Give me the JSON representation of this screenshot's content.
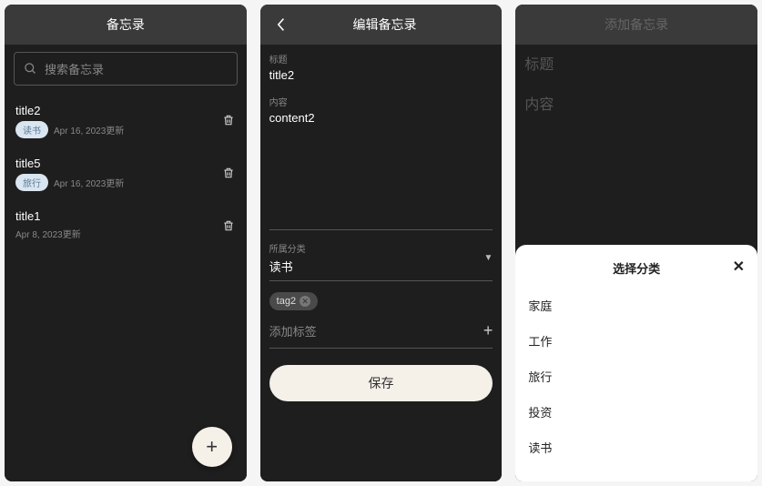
{
  "screen1": {
    "title": "备忘录",
    "search": {
      "placeholder": "搜索备忘录"
    },
    "items": [
      {
        "title": "title2",
        "category": "读书",
        "date": "Apr 16, 2023更新",
        "hasCategory": true
      },
      {
        "title": "title5",
        "category": "旅行",
        "date": "Apr 16, 2023更新",
        "hasCategory": true
      },
      {
        "title": "title1",
        "category": "",
        "date": "Apr 8, 2023更新",
        "hasCategory": false
      }
    ],
    "fab_label": "+"
  },
  "screen2": {
    "title": "编辑备忘录",
    "title_label": "标题",
    "title_value": "title2",
    "content_label": "内容",
    "content_value": "content2",
    "category_label": "所属分类",
    "category_value": "读书",
    "tags": [
      {
        "label": "tag2"
      }
    ],
    "add_tag_label": "添加标签",
    "save_label": "保存"
  },
  "screen3": {
    "title": "添加备忘录",
    "title_placeholder": "标题",
    "content_placeholder": "内容",
    "sheet": {
      "title": "选择分类",
      "close": "✕",
      "options": [
        "家庭",
        "工作",
        "旅行",
        "投资",
        "读书"
      ]
    }
  }
}
